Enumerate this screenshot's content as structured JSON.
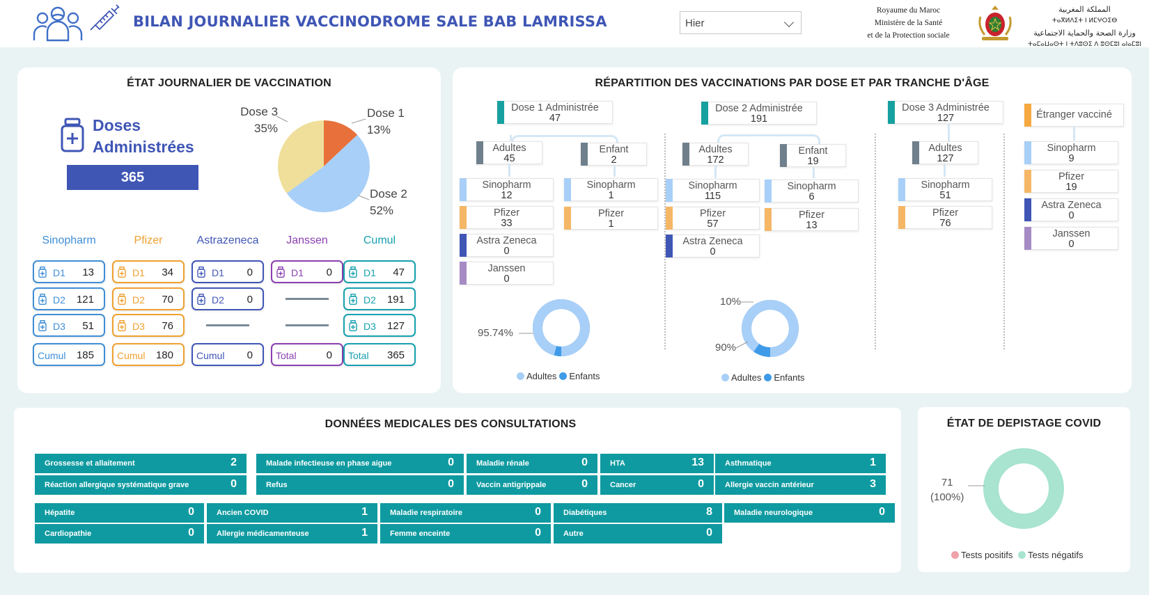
{
  "header": {
    "title": "BILAN JOURNALIER VACCINODROME SALE BAB LAMRISSA",
    "date_filter": "Hier",
    "ministry_fr": [
      "Royaume du Maroc",
      "Ministère de la Santé",
      "et de la Protection sociale"
    ],
    "ministry_ar": [
      "المملكة المغربية",
      "ⵜⴰⴳⵍⴷⵉⵜ ⵏ ⵍⵎⵖⵔⵉⴱ",
      "وزارة الصحة والحماية الاجتماعية",
      "ⵜⴰⵎⴰⵡⴰⵙⵜ ⵏ ⵜⴷⵓⵙⵉ ⴷ ⵓⵙⵎⵓⵏ ⴰⵏⴰⵎⵓⵏ"
    ]
  },
  "daily": {
    "title": "ÉTAT JOURNALIER DE VACCINATION",
    "doses_label_1": "Doses",
    "doses_label_2": "Administrées",
    "doses_total": "365",
    "pie": [
      {
        "label": "Dose 1",
        "pct": "13%",
        "value": 13,
        "color": "#e8703a"
      },
      {
        "label": "Dose 2",
        "pct": "52%",
        "value": 52,
        "color": "#a8cff7"
      },
      {
        "label": "Dose 3",
        "pct": "35%",
        "value": 35,
        "color": "#efdf9a"
      }
    ],
    "vaccines": [
      {
        "name": "Sinopharm",
        "color": "#3f8ed6",
        "rows": [
          {
            "lbl": "D1",
            "val": "13"
          },
          {
            "lbl": "D2",
            "val": "121"
          },
          {
            "lbl": "D3",
            "val": "51"
          }
        ],
        "cum_lbl": "Cumul",
        "cum_val": "185"
      },
      {
        "name": "Pfizer",
        "color": "#f0a030",
        "rows": [
          {
            "lbl": "D1",
            "val": "34"
          },
          {
            "lbl": "D2",
            "val": "70"
          },
          {
            "lbl": "D3",
            "val": "76"
          }
        ],
        "cum_lbl": "Cumul",
        "cum_val": "180"
      },
      {
        "name": "Astrazeneca",
        "color": "#3f56b5",
        "rows": [
          {
            "lbl": "D1",
            "val": "0"
          },
          {
            "lbl": "D2",
            "val": "0"
          }
        ],
        "cum_lbl": "Cumul",
        "cum_val": "0"
      },
      {
        "name": "Janssen",
        "color": "#8a3fb0",
        "rows": [
          {
            "lbl": "D1",
            "val": "0"
          }
        ],
        "cum_lbl": "Total",
        "cum_val": "0"
      },
      {
        "name": "Cumul",
        "color": "#16a0b0",
        "rows": [
          {
            "lbl": "D1",
            "val": "47"
          },
          {
            "lbl": "D2",
            "val": "191"
          },
          {
            "lbl": "D3",
            "val": "127"
          }
        ],
        "cum_lbl": "Total",
        "cum_val": "365"
      }
    ]
  },
  "repartition": {
    "title": "RÉPARTITION DES VACCINATIONS PAR DOSE ET PAR TRANCHE D'ÂGE",
    "dose1": {
      "label": "Dose 1 Administrée",
      "value": "47",
      "adultes": {
        "label": "Adultes",
        "value": "45"
      },
      "enfant": {
        "label": "Enfant",
        "value": "2"
      },
      "adult_vaccines": [
        {
          "name": "Sinopharm",
          "value": "12"
        },
        {
          "name": "Pfizer",
          "value": "33"
        },
        {
          "name": "Astra Zeneca",
          "value": "0"
        },
        {
          "name": "Janssen",
          "value": "0"
        }
      ],
      "child_vaccines": [
        {
          "name": "Sinopharm",
          "value": "1"
        },
        {
          "name": "Pfizer",
          "value": "1"
        }
      ],
      "donut": {
        "adultes_pct": 95.74,
        "label": "95.74%"
      }
    },
    "dose2": {
      "label": "Dose 2 Administrée",
      "value": "191",
      "adultes": {
        "label": "Adultes",
        "value": "172"
      },
      "enfant": {
        "label": "Enfant",
        "value": "19"
      },
      "adult_vaccines": [
        {
          "name": "Sinopharm",
          "value": "115"
        },
        {
          "name": "Pfizer",
          "value": "57"
        },
        {
          "name": "Astra Zeneca",
          "value": "0"
        }
      ],
      "child_vaccines": [
        {
          "name": "Sinopharm",
          "value": "6"
        },
        {
          "name": "Pfizer",
          "value": "13"
        }
      ],
      "donut": {
        "adultes_pct": 90,
        "label_a": "90%",
        "label_e": "10%"
      }
    },
    "dose3": {
      "label": "Dose 3 Administrée",
      "value": "127",
      "adultes": {
        "label": "Adultes",
        "value": "127"
      },
      "adult_vaccines": [
        {
          "name": "Sinopharm",
          "value": "51"
        },
        {
          "name": "Pfizer",
          "value": "76"
        }
      ]
    },
    "etranger": {
      "label": "Étranger vacciné",
      "vaccines": [
        {
          "name": "Sinopharm",
          "value": "9"
        },
        {
          "name": "Pfizer",
          "value": "19"
        },
        {
          "name": "Astra Zeneca",
          "value": "0"
        },
        {
          "name": "Janssen",
          "value": "0"
        }
      ]
    },
    "legend": {
      "adultes": "Adultes",
      "enfants": "Enfants"
    },
    "colors": {
      "dose_bar": "#16a0a0",
      "age_bar": "#6f808c",
      "sinopharm": "#a8cff7",
      "pfizer": "#f5b766",
      "astra": "#3f56b5",
      "janssen": "#a68ac4",
      "etranger": "#f5a940",
      "adultes": "#a8cff7",
      "enfants": "#3f9be8"
    }
  },
  "medical": {
    "title": "DONNÉES MEDICALES DES CONSULTATIONS",
    "row1": [
      {
        "label": "Grossesse et allaitement",
        "value": "2"
      },
      {
        "label": "Malade infectieuse en phase aigue",
        "value": "0"
      },
      {
        "label": "Maladie rénale",
        "value": "0"
      },
      {
        "label": "HTA",
        "value": "13"
      },
      {
        "label": "Asthmatique",
        "value": "1"
      }
    ],
    "row2": [
      {
        "label": "Réaction allergique systématique grave",
        "value": "0"
      },
      {
        "label": "Refus",
        "value": "0"
      },
      {
        "label": "Vaccin antigrippale",
        "value": "0"
      },
      {
        "label": "Cancer",
        "value": "0"
      },
      {
        "label": "Allergie vaccin antérieur",
        "value": "3"
      }
    ],
    "row3": [
      {
        "label": "Hépatite",
        "value": "0"
      },
      {
        "label": "Ancien COVID",
        "value": "1"
      },
      {
        "label": "Maladie respiratoire",
        "value": "0"
      },
      {
        "label": "Diabétiques",
        "value": "8"
      },
      {
        "label": "Maladie neurologique",
        "value": "0"
      }
    ],
    "row4": [
      {
        "label": "Cardiopathie",
        "value": "0"
      },
      {
        "label": "Allergie médicamenteuse",
        "value": "1"
      },
      {
        "label": "Femme enceinte",
        "value": "0"
      },
      {
        "label": "Autre",
        "value": "0"
      }
    ]
  },
  "depistage": {
    "title": "ÉTAT DE DEPISTAGE COVID",
    "negatifs": 71,
    "label_value": "71",
    "label_pct": "(100%)",
    "legend_pos": "Tests positifs",
    "legend_neg": "Tests négatifs",
    "color_pos": "#f0a0a8",
    "color_neg": "#a8e4d0"
  }
}
